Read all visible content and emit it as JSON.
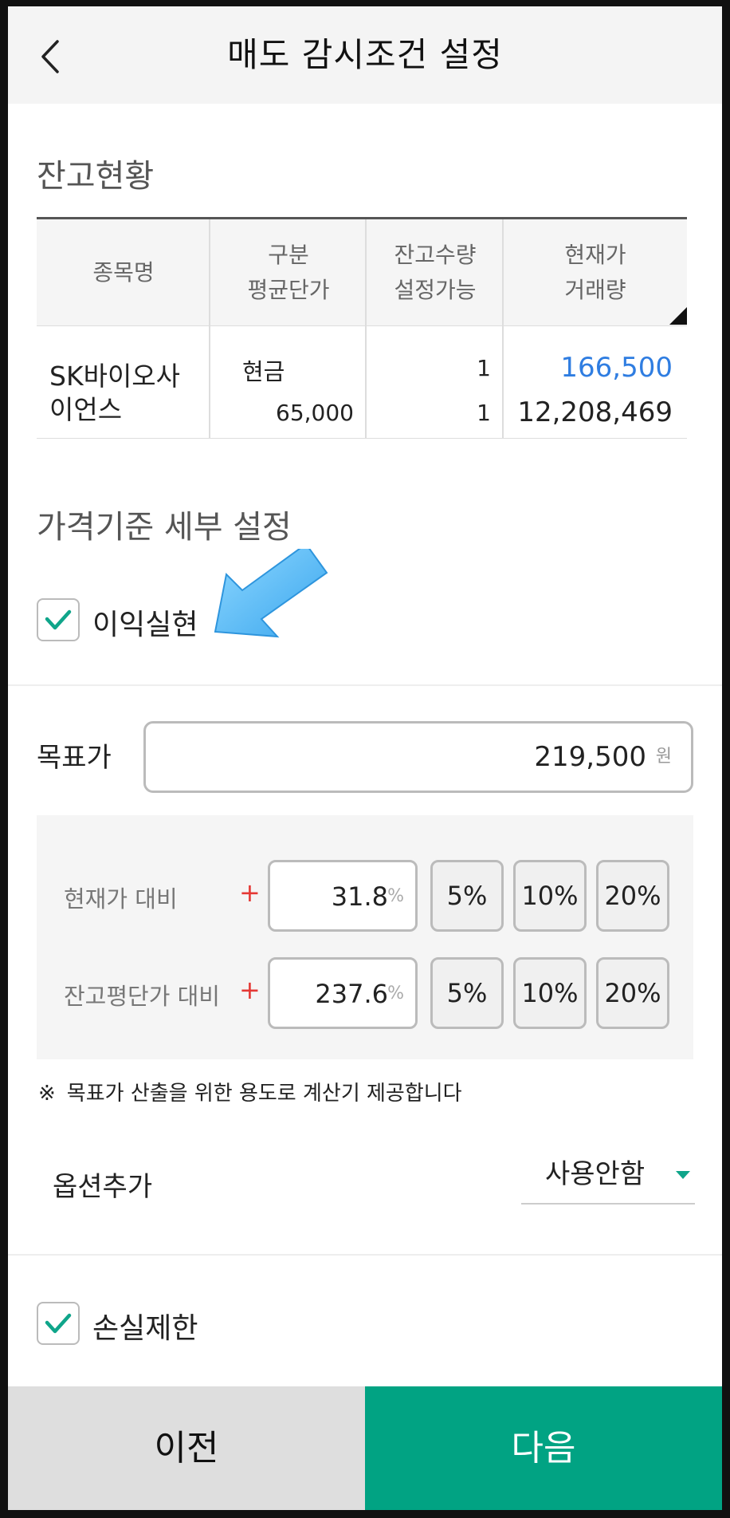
{
  "header": {
    "title": "매도 감시조건 설정"
  },
  "holdings": {
    "section_title": "잔고현황",
    "headers": {
      "col1": "종목명",
      "col2_line1": "구분",
      "col2_line2": "평균단가",
      "col3_line1": "잔고수량",
      "col3_line2": "설정가능",
      "col4_line1": "현재가",
      "col4_line2": "거래량"
    },
    "row": {
      "name_line1": "SK바이오사",
      "name_line2": "이언스",
      "type": "현금",
      "avg_price": "65,000",
      "qty": "1",
      "available": "1",
      "current_price": "166,500",
      "volume": "12,208,469"
    }
  },
  "price_settings": {
    "section_title": "가격기준 세부 설정",
    "profit_label": "이익실현",
    "target_label": "목표가",
    "target_value": "219,500",
    "target_unit": "원",
    "vs_current_label": "현재가 대비",
    "vs_current_sign": "+",
    "vs_current_value": "31.8",
    "vs_avg_label": "잔고평단가 대비",
    "vs_avg_sign": "+",
    "vs_avg_value": "237.6",
    "pct_unit": "%",
    "quick_buttons": [
      "5%",
      "10%",
      "20%"
    ],
    "note_mark": "※",
    "note_text": "목표가 산출을 위한 용도로 계산기 제공합니다",
    "option_label": "옵션추가",
    "option_value": "사용안함",
    "loss_label": "손실제한"
  },
  "footer": {
    "prev_label": "이전",
    "next_label": "다음"
  },
  "colors": {
    "accent": "#01a383",
    "price_blue": "#2f7de1",
    "plus_red": "#e53935"
  }
}
